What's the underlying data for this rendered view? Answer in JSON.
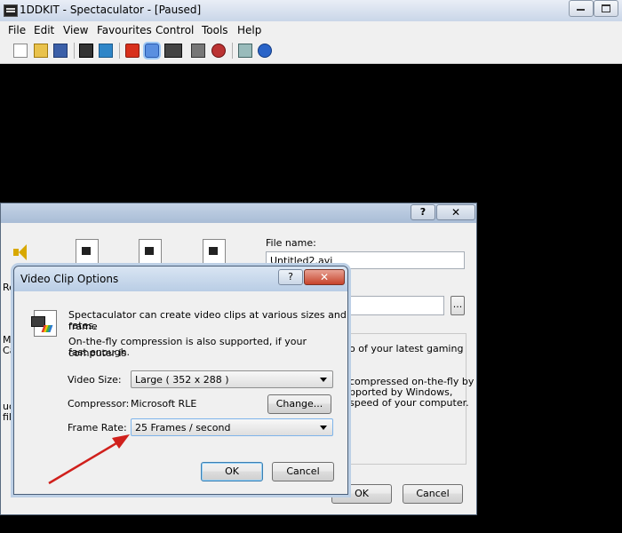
{
  "window": {
    "title": "1DDKIT - Spectaculator - [Paused]"
  },
  "menu": [
    "File",
    "Edit",
    "View",
    "Favourites",
    "Control",
    "Tools",
    "Help"
  ],
  "toolbar": {
    "icons": [
      "new-icon",
      "open-icon",
      "save-icon",
      "tape-icon",
      "snapshot-icon",
      "reset-icon",
      "pause-icon",
      "keyboard-icon",
      "disk-icon",
      "record-icon",
      "joystick-icon",
      "help-icon"
    ]
  },
  "save_dialog": {
    "help": "?",
    "close": "✕",
    "left_fragments": [
      "Re",
      "Mic",
      "Ca",
      "udio",
      "file"
    ],
    "file_name_label": "File name:",
    "file_name_value": "Untitled2.avi",
    "browse": "...",
    "info_lines": [
      "o of your latest gaming",
      "compressed on-the-fly by",
      "pported by Windows,",
      "speed of your computer."
    ],
    "ok": "OK",
    "cancel": "Cancel"
  },
  "clip_dialog": {
    "title": "Video Clip Options",
    "help": "?",
    "close": "✕",
    "intro1a": "Spectaculator can create video clips at various sizes and frame",
    "intro1b": "rates.",
    "intro2a": "On-the-fly compression is also supported, if your computer is",
    "intro2b": "fast enough.",
    "video_size_label": "Video Size:",
    "video_size_value": "Large ( 352 x 288 )",
    "compressor_label": "Compressor:",
    "compressor_value": "Microsoft RLE",
    "change": "Change...",
    "frame_rate_label": "Frame Rate:",
    "frame_rate_value": "25 Frames / second",
    "ok": "OK",
    "cancel": "Cancel"
  },
  "colors": {
    "arrow": "#d0201c",
    "background": "#000000"
  }
}
